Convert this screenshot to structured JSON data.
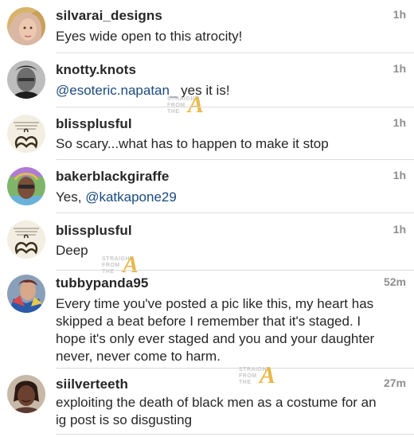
{
  "comments": [
    {
      "username": "silvarai_designs",
      "time": "1h",
      "text": "Eyes wide open to this atrocity!",
      "avatar_icon": "profile-photo-woman-blonde"
    },
    {
      "username": "knotty.knots",
      "time": "1h",
      "mention": "@esoteric.napatan_",
      "text": " yes it is!",
      "avatar_icon": "profile-photo-man-bw"
    },
    {
      "username": "blissplusful",
      "time": "1h",
      "text": "So scary...what has to happen to make it stop",
      "avatar_icon": "profile-logo-calligraphy"
    },
    {
      "username": "bakerblackgiraffe",
      "time": "1h",
      "prefix": "Yes, ",
      "mention": "@katkapone29",
      "avatar_icon": "profile-photo-rainbow"
    },
    {
      "username": "blissplusful",
      "time": "1h",
      "text": "Deep",
      "avatar_icon": "profile-logo-calligraphy"
    },
    {
      "username": "tubbypanda95",
      "time": "52m",
      "text_lines": [
        "Every time you've posted a pic like this, my heart has",
        "skipped a beat before I remember that it's staged. I",
        "hope it's only ever staged and you and your daughter",
        "never, never come to harm."
      ],
      "avatar_icon": "profile-photo-woman-fan"
    },
    {
      "username": "siilverteeth",
      "time": "27m",
      "text_lines": [
        "exploiting the death of black men as a costume for an",
        "ig post is so disgusting"
      ],
      "avatar_icon": "profile-photo-woman-dark"
    }
  ],
  "watermark": {
    "line1": "STRAIGHT",
    "line2": "FROM",
    "line3": "THE",
    "letter": "A"
  },
  "colors": {
    "text": "#262626",
    "time": "#8e8e8e",
    "mention": "#1a4a7f",
    "divider": "#dbdbdb",
    "watermark_accent": "#e8b84a"
  }
}
